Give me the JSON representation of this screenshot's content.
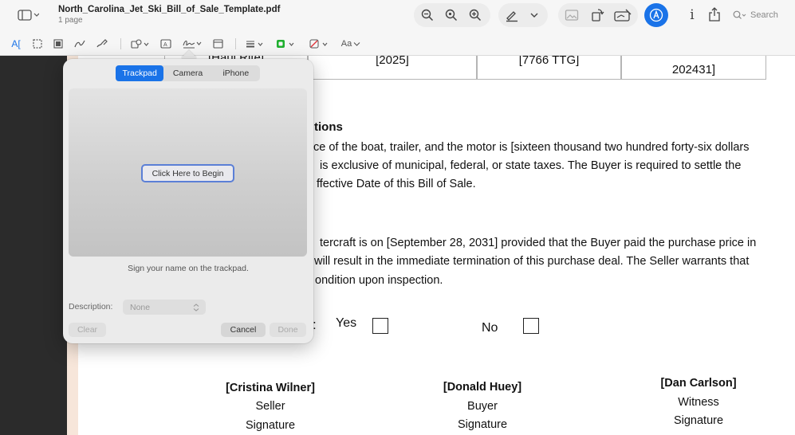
{
  "toolbar": {
    "doc_title": "North_Carolina_Jet_Ski_Bill_of_Sale_Template.pdf",
    "doc_pages": "1 page",
    "search_placeholder": "Search",
    "text_style_label": "Aa",
    "accent_color": "#1a73e8"
  },
  "document": {
    "table_row": {
      "cell1": "[Haul Rite]",
      "cell2": "[2025]",
      "cell3": "[7766 TTG]",
      "cell4": "202431]"
    },
    "payment_heading_tail": "tions",
    "payment_lines": [
      "ce of the boat, trailer, and the motor is [sixteen thousand two hundred forty-six dollars",
      "is exclusive of municipal, federal, or state taxes. The Buyer is required to settle the",
      "ffective Date of this Bill of Sale."
    ],
    "delivery_lines": [
      "tercraft is on [September 28, 2031] provided that the Buyer paid the purchase price in",
      "will result in the immediate termination of this purchase deal. The Seller warrants that",
      "ondition upon inspection."
    ],
    "renew": {
      "colon": ":",
      "yes_label": "Yes",
      "no_label": "No"
    },
    "signatures": [
      {
        "name": "[Cristina Wilner]",
        "role": "Seller",
        "label": "Signature"
      },
      {
        "name": "[Donald Huey]",
        "role": "Buyer",
        "label": "Signature"
      },
      {
        "name": "[Dan Carlson]",
        "role": "Witness",
        "label": "Signature"
      }
    ]
  },
  "signature_popover": {
    "tabs": [
      "Trackpad",
      "Camera",
      "iPhone"
    ],
    "active_tab": "Trackpad",
    "begin_button": "Click Here to Begin",
    "hint": "Sign your name on the trackpad.",
    "description_label": "Description:",
    "description_value": "None",
    "clear_button": "Clear",
    "cancel_button": "Cancel",
    "done_button": "Done"
  }
}
